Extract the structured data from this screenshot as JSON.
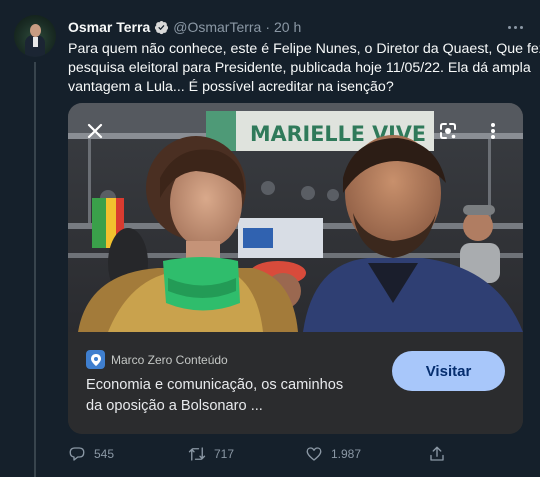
{
  "tweet": {
    "author_name": "Osmar Terra",
    "handle": "@OsmarTerra",
    "separator": "·",
    "time": "20 h",
    "text_lines": [
      "Para quem não conhece, este é Felipe Nunes, o Diretor da Quaest, Que fez",
      "pesquisa eleitoral para Presidente, publicada hoje 11/05/22. Ela dá ampla",
      "vantagem a Lula... É possível acreditar na isenção?"
    ]
  },
  "card": {
    "banner_text": "MARIELLE VIVE",
    "site_name": "Marco Zero Conteúdo",
    "headline_lines": [
      "Economia e comunicação, os caminhos",
      "da oposição a Bolsonaro ..."
    ],
    "visit_label": "Visitar"
  },
  "actions": {
    "reply_count": "545",
    "retweet_count": "717",
    "like_count": "1.987"
  },
  "icons": {
    "verified": "verified-badge-icon",
    "more": "more-horizontal-icon",
    "close": "close-icon",
    "lens": "google-lens-icon",
    "card_more": "more-vertical-icon",
    "reply": "reply-icon",
    "retweet": "retweet-icon",
    "like": "heart-icon",
    "share": "share-icon"
  },
  "colors": {
    "background": "#15202b",
    "accent": "#1d9bf0",
    "secondary_text": "#8b98a5",
    "visit_button": "#a8c7fa"
  }
}
